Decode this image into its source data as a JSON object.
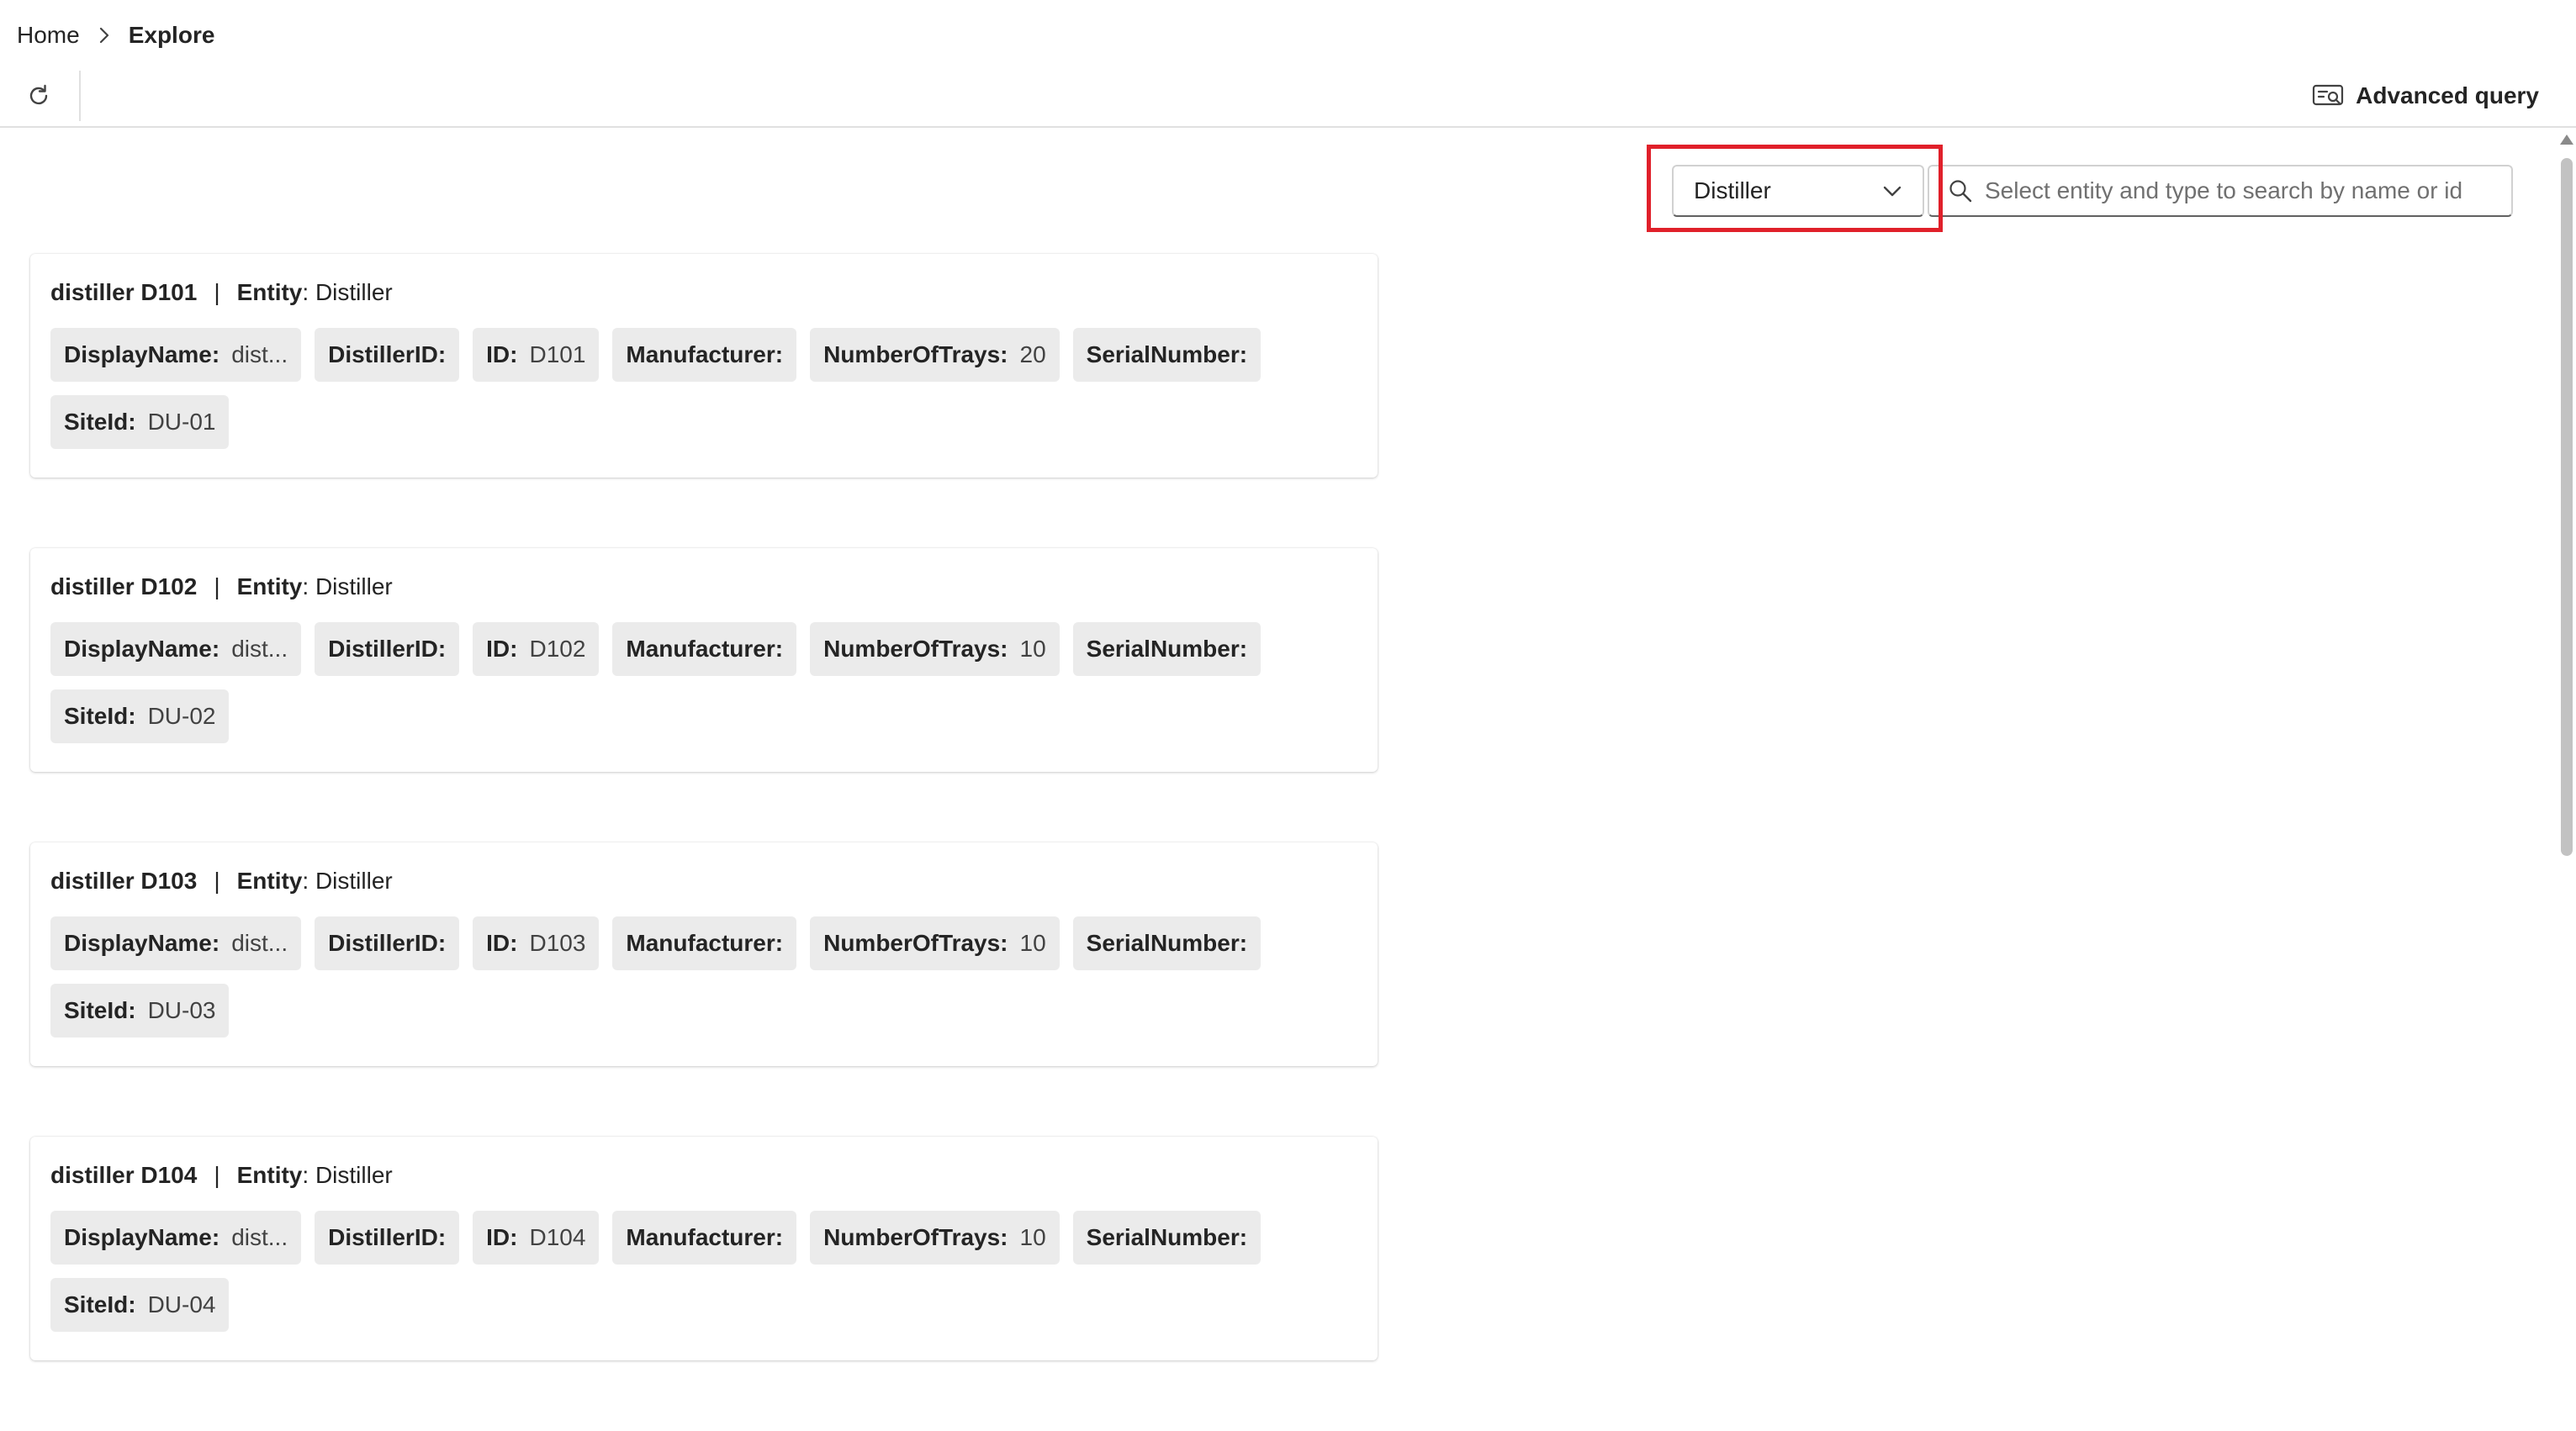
{
  "breadcrumb": {
    "home": "Home",
    "current": "Explore"
  },
  "toolbar": {
    "refresh_icon": "refresh-icon",
    "advanced_query_label": "Advanced query",
    "advanced_query_icon": "query-icon"
  },
  "filter": {
    "entity_selected": "Distiller",
    "search_placeholder": "Select entity and type to search by name or id",
    "search_value": ""
  },
  "colors": {
    "highlight": "#e0202a",
    "chip_bg": "#ebebeb",
    "accent_text": "#242424"
  },
  "results": [
    {
      "name": "distiller D101",
      "entity_label": "Entity",
      "entity_value": "Distiller",
      "props": {
        "display_name_key": "DisplayName:",
        "display_name_val": "dist...",
        "distiller_id_key": "DistillerID:",
        "distiller_id_val": "",
        "id_key": "ID:",
        "id_val": "D101",
        "manufacturer_key": "Manufacturer:",
        "manufacturer_val": "",
        "trays_key": "NumberOfTrays:",
        "trays_val": "20",
        "serial_key": "SerialNumber:",
        "serial_val": "",
        "site_key": "SiteId:",
        "site_val": "DU-01"
      }
    },
    {
      "name": "distiller D102",
      "entity_label": "Entity",
      "entity_value": "Distiller",
      "props": {
        "display_name_key": "DisplayName:",
        "display_name_val": "dist...",
        "distiller_id_key": "DistillerID:",
        "distiller_id_val": "",
        "id_key": "ID:",
        "id_val": "D102",
        "manufacturer_key": "Manufacturer:",
        "manufacturer_val": "",
        "trays_key": "NumberOfTrays:",
        "trays_val": "10",
        "serial_key": "SerialNumber:",
        "serial_val": "",
        "site_key": "SiteId:",
        "site_val": "DU-02"
      }
    },
    {
      "name": "distiller D103",
      "entity_label": "Entity",
      "entity_value": "Distiller",
      "props": {
        "display_name_key": "DisplayName:",
        "display_name_val": "dist...",
        "distiller_id_key": "DistillerID:",
        "distiller_id_val": "",
        "id_key": "ID:",
        "id_val": "D103",
        "manufacturer_key": "Manufacturer:",
        "manufacturer_val": "",
        "trays_key": "NumberOfTrays:",
        "trays_val": "10",
        "serial_key": "SerialNumber:",
        "serial_val": "",
        "site_key": "SiteId:",
        "site_val": "DU-03"
      }
    },
    {
      "name": "distiller D104",
      "entity_label": "Entity",
      "entity_value": "Distiller",
      "props": {
        "display_name_key": "DisplayName:",
        "display_name_val": "dist...",
        "distiller_id_key": "DistillerID:",
        "distiller_id_val": "",
        "id_key": "ID:",
        "id_val": "D104",
        "manufacturer_key": "Manufacturer:",
        "manufacturer_val": "",
        "trays_key": "NumberOfTrays:",
        "trays_val": "10",
        "serial_key": "SerialNumber:",
        "serial_val": "",
        "site_key": "SiteId:",
        "site_val": "DU-04"
      }
    }
  ]
}
